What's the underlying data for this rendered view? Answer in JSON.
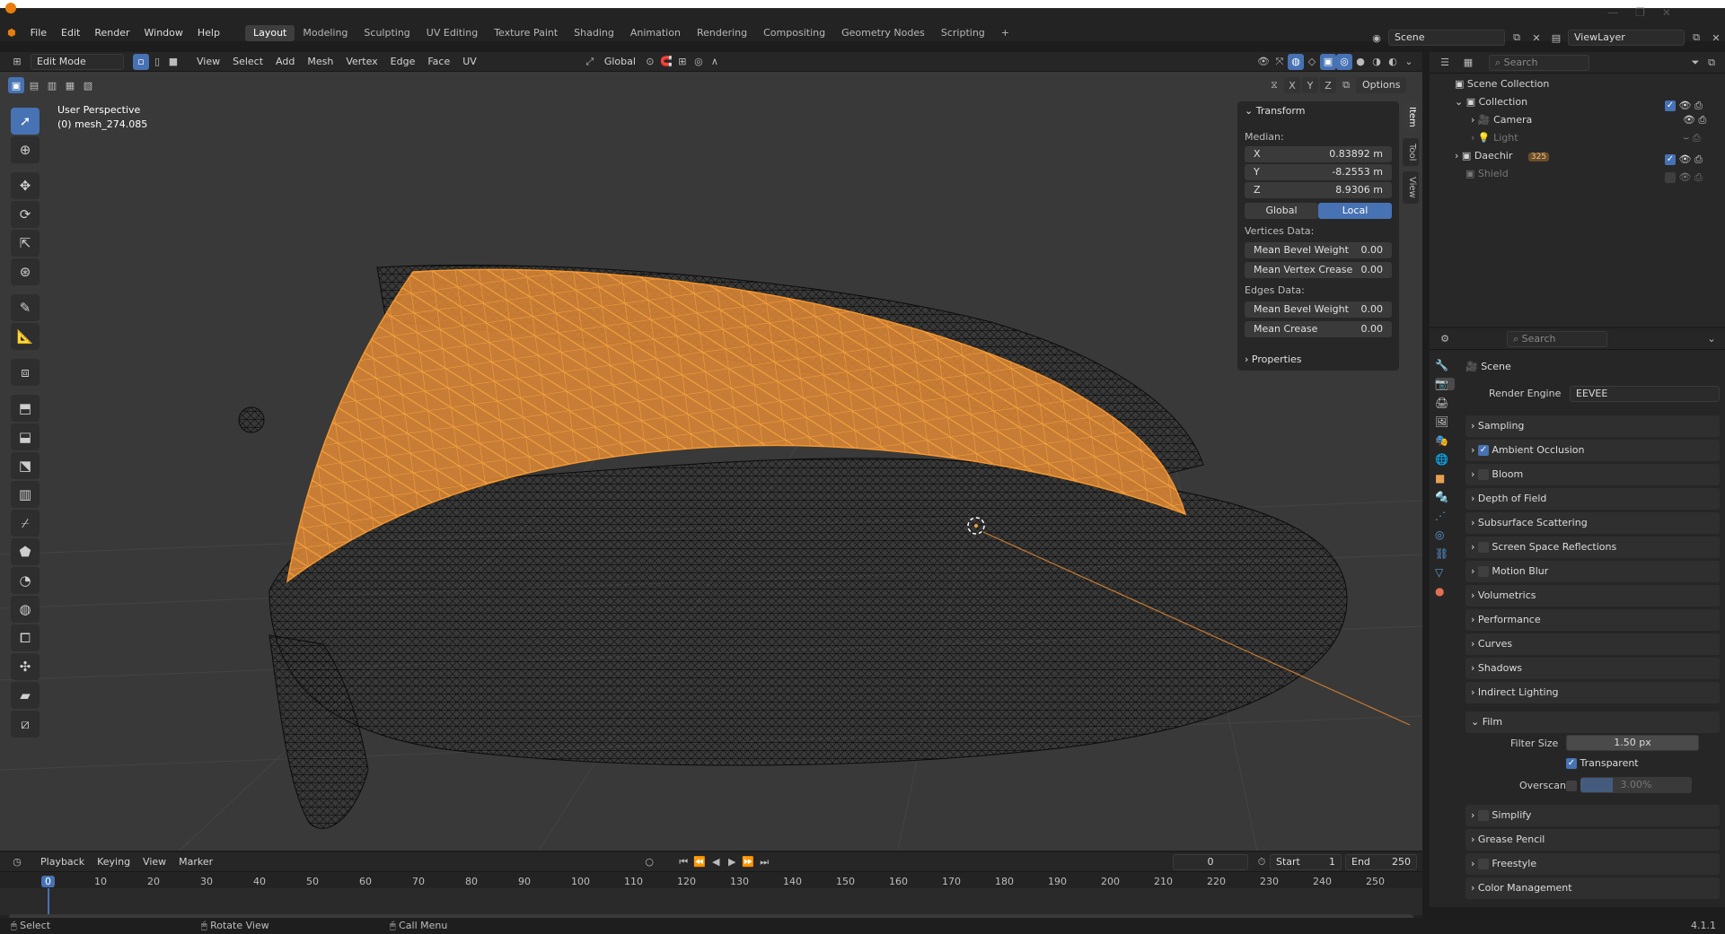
{
  "topbar": {
    "menu": [
      "File",
      "Edit",
      "Render",
      "Window",
      "Help"
    ],
    "workspaces": [
      "Layout",
      "Modeling",
      "Sculpting",
      "UV Editing",
      "Texture Paint",
      "Shading",
      "Animation",
      "Rendering",
      "Compositing",
      "Geometry Nodes",
      "Scripting"
    ],
    "active_workspace": "Layout",
    "add_workspace": "+",
    "scene": "Scene",
    "view_layer": "ViewLayer"
  },
  "viewport_header": {
    "mode": "Edit Mode",
    "menus": [
      "View",
      "Select",
      "Add",
      "Mesh",
      "Vertex",
      "Edge",
      "Face",
      "UV"
    ],
    "orientation": "Global",
    "options": "Options",
    "axes": [
      "X",
      "Y",
      "Z"
    ]
  },
  "viewport": {
    "perspective": "User Perspective",
    "object": "(0) mesh_274.085",
    "colors": {
      "selected": "#f5962e",
      "wire": "#0a0a0a",
      "bg": "#3a3a3a"
    }
  },
  "npanel": {
    "tabs": [
      "Item",
      "Tool",
      "View"
    ],
    "transform_title": "Transform",
    "median_label": "Median:",
    "x_label": "X",
    "x_value": "0.83892 m",
    "y_label": "Y",
    "y_value": "-8.2553 m",
    "z_label": "Z",
    "z_value": "8.9306 m",
    "global": "Global",
    "local": "Local",
    "vertices_data": "Vertices Data:",
    "mean_bevel_weight": "Mean Bevel Weight",
    "mbw_value": "0.00",
    "mean_vertex_crease": "Mean Vertex Crease",
    "mvc_value": "0.00",
    "edges_data": "Edges Data:",
    "edge_bevel_weight": "Mean Bevel Weight",
    "ebw_value": "0.00",
    "mean_crease": "Mean Crease",
    "mc_value": "0.00",
    "properties": "Properties"
  },
  "outliner": {
    "search_placeholder": "Search",
    "scene_collection": "Scene Collection",
    "collection": "Collection",
    "camera": "Camera",
    "light": "Light",
    "daechir": "Daechir",
    "daechir_badge": "325",
    "shield": "Shield"
  },
  "properties": {
    "search_placeholder": "Search",
    "scene": "Scene",
    "render_engine_label": "Render Engine",
    "render_engine": "EEVEE",
    "panels": [
      {
        "label": "Sampling",
        "check": false,
        "checked": false
      },
      {
        "label": "Ambient Occlusion",
        "check": true,
        "checked": true
      },
      {
        "label": "Bloom",
        "check": true,
        "checked": false
      },
      {
        "label": "Depth of Field",
        "check": false,
        "checked": false
      },
      {
        "label": "Subsurface Scattering",
        "check": false,
        "checked": false
      },
      {
        "label": "Screen Space Reflections",
        "check": true,
        "checked": false
      },
      {
        "label": "Motion Blur",
        "check": true,
        "checked": false
      },
      {
        "label": "Volumetrics",
        "check": false,
        "checked": false
      },
      {
        "label": "Performance",
        "check": false,
        "checked": false
      },
      {
        "label": "Curves",
        "check": false,
        "checked": false
      },
      {
        "label": "Shadows",
        "check": false,
        "checked": false
      },
      {
        "label": "Indirect Lighting",
        "check": false,
        "checked": false
      }
    ],
    "film": "Film",
    "filter_size_label": "Filter Size",
    "filter_size": "1.50 px",
    "transparent": "Transparent",
    "overscan_label": "Overscan",
    "overscan": "3.00%",
    "panels2": [
      {
        "label": "Simplify",
        "check": true
      },
      {
        "label": "Grease Pencil",
        "check": false
      },
      {
        "label": "Freestyle",
        "check": true
      },
      {
        "label": "Color Management",
        "check": false
      }
    ]
  },
  "timeline": {
    "menus": [
      "Playback",
      "Keying",
      "View",
      "Marker"
    ],
    "current_frame": "0",
    "start_label": "Start",
    "start": "1",
    "end_label": "End",
    "end": "250",
    "ticks": [
      "0",
      "10",
      "20",
      "30",
      "40",
      "50",
      "60",
      "70",
      "80",
      "90",
      "100",
      "110",
      "120",
      "130",
      "140",
      "150",
      "160",
      "170",
      "180",
      "190",
      "200",
      "210",
      "220",
      "230",
      "240",
      "250"
    ]
  },
  "statusbar": {
    "select": "Select",
    "rotate": "Rotate View",
    "call_menu": "Call Menu",
    "version": "4.1.1"
  }
}
